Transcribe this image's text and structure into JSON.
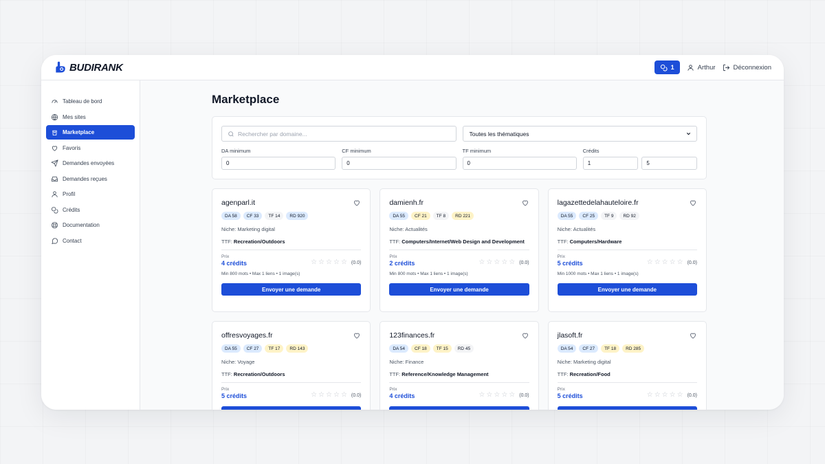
{
  "brand": {
    "name": "BUDIRANK"
  },
  "header": {
    "credits_count": "1",
    "user": "Arthur",
    "logout": "Déconnexion"
  },
  "sidebar": {
    "items": [
      {
        "label": "Tableau de bord",
        "icon": "gauge-icon"
      },
      {
        "label": "Mes sites",
        "icon": "globe-icon"
      },
      {
        "label": "Marketplace",
        "icon": "shopping-bag-icon",
        "active": true
      },
      {
        "label": "Favoris",
        "icon": "heart-icon"
      },
      {
        "label": "Demandes envoyées",
        "icon": "send-icon"
      },
      {
        "label": "Demandes reçues",
        "icon": "inbox-icon"
      },
      {
        "label": "Profil",
        "icon": "user-icon"
      },
      {
        "label": "Crédits",
        "icon": "coins-icon"
      },
      {
        "label": "Documentation",
        "icon": "lifebuoy-icon"
      },
      {
        "label": "Contact",
        "icon": "message-circle-icon"
      }
    ]
  },
  "page": {
    "title": "Marketplace"
  },
  "filters": {
    "search_placeholder": "Rechercher par domaine...",
    "theme_selected": "Toutes les thématiques",
    "da_label": "DA minimum",
    "da_value": "0",
    "cf_label": "CF minimum",
    "cf_value": "0",
    "tf_label": "TF minimum",
    "tf_value": "0",
    "credits_label": "Crédits",
    "credits_min": "1",
    "credits_max": "5"
  },
  "card_labels": {
    "price": "Prix",
    "button": "Envoyer une demande",
    "niche_prefix": "Niche: ",
    "ttf_prefix": "TTF: "
  },
  "cards": [
    {
      "domain": "agenparl.it",
      "tags": [
        {
          "t": "DA 58",
          "c": "blue"
        },
        {
          "t": "CF 33",
          "c": "blue"
        },
        {
          "t": "TF 14",
          "c": "gray"
        },
        {
          "t": "RD 920",
          "c": "blue"
        }
      ],
      "niche": "Marketing digital",
      "ttf": "Recreation/Outdoors",
      "price": "4 crédits",
      "rating": "(0.0)",
      "meta": "Min 800 mots • Max 1 liens • 1 image(s)"
    },
    {
      "domain": "damienh.fr",
      "tags": [
        {
          "t": "DA 55",
          "c": "blue"
        },
        {
          "t": "CF 21",
          "c": "yellow"
        },
        {
          "t": "TF 8",
          "c": "gray"
        },
        {
          "t": "RD 221",
          "c": "yellow"
        }
      ],
      "niche": "Actualités",
      "ttf": "Computers/Internet/Web Design and Development",
      "price": "2 crédits",
      "rating": "(0.0)",
      "meta": "Min 800 mots • Max 1 liens • 1 image(s)"
    },
    {
      "domain": "lagazettedelahauteloire.fr",
      "tags": [
        {
          "t": "DA 55",
          "c": "blue"
        },
        {
          "t": "CF 25",
          "c": "blue"
        },
        {
          "t": "TF 9",
          "c": "gray"
        },
        {
          "t": "RD 92",
          "c": "gray"
        }
      ],
      "niche": "Actualités",
      "ttf": "Computers/Hardware",
      "price": "5 crédits",
      "rating": "(0.0)",
      "meta": "Min 1000 mots • Max 1 liens • 1 image(s)"
    },
    {
      "domain": "offresvoyages.fr",
      "tags": [
        {
          "t": "DA 55",
          "c": "blue"
        },
        {
          "t": "CF 27",
          "c": "blue"
        },
        {
          "t": "TF 17",
          "c": "yellow"
        },
        {
          "t": "RD 143",
          "c": "yellow"
        }
      ],
      "niche": "Voyage",
      "ttf": "Recreation/Outdoors",
      "price": "5 crédits",
      "rating": "(0.0)",
      "meta": ""
    },
    {
      "domain": "123finances.fr",
      "tags": [
        {
          "t": "DA 54",
          "c": "blue"
        },
        {
          "t": "CF 18",
          "c": "yellow"
        },
        {
          "t": "TF 15",
          "c": "yellow"
        },
        {
          "t": "RD 45",
          "c": "gray"
        }
      ],
      "niche": "Finance",
      "ttf": "Reference/Knowledge Management",
      "price": "4 crédits",
      "rating": "(0.0)",
      "meta": ""
    },
    {
      "domain": "jlasoft.fr",
      "tags": [
        {
          "t": "DA 54",
          "c": "blue"
        },
        {
          "t": "CF 27",
          "c": "blue"
        },
        {
          "t": "TF 18",
          "c": "yellow"
        },
        {
          "t": "RD 285",
          "c": "yellow"
        }
      ],
      "niche": "Marketing digital",
      "ttf": "Recreation/Food",
      "price": "5 crédits",
      "rating": "(0.0)",
      "meta": ""
    }
  ],
  "colors": {
    "accent": "#1d4ed8",
    "tag_blue": "#dbeafe",
    "tag_yellow": "#fef3c7",
    "tag_gray": "#f3f4f6"
  }
}
